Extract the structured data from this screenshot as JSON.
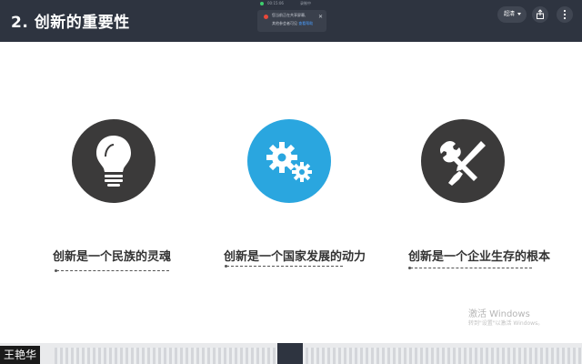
{
  "slide": {
    "title": "2. 创新的重要性",
    "captions": [
      "创新是一个民族的灵魂",
      "创新是一个国家发展的动力",
      "创新是一个企业生存的根本"
    ]
  },
  "toolbar": {
    "quality_label": "超清",
    "notice_line1": "您当前正在共享屏幕,",
    "notice_line2": "其他参会者可见",
    "notice_link": "查看帮助",
    "status_time": "00:15:06",
    "status_label": "录制中"
  },
  "windows_watermark": {
    "line1": "激活 Windows",
    "line2": "转到\"设置\"以激活 Windows。"
  },
  "participant": {
    "name": "王艳华"
  },
  "colors": {
    "topbar": "#2e3440",
    "icon_dark": "#3b3a3a",
    "icon_blue": "#2aa6df"
  },
  "icons": [
    "lightbulb-icon",
    "gears-icon",
    "tools-icon"
  ]
}
